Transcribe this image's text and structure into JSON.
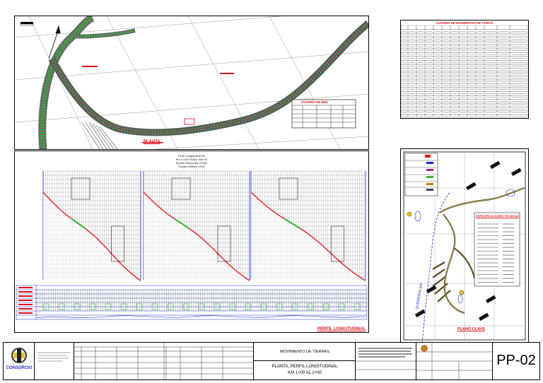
{
  "plan": {
    "title_label": "PLANTA",
    "table_title": "CUADRO DE BMs"
  },
  "curve_table": {
    "title": "CUADRO DE ELEMENTOS DE CURVA"
  },
  "profile": {
    "heading_lines": [
      "Perfil Longitudinal Nu",
      "Km 1+100.00@1+480.00",
      "Escala Horizontal 1/2000",
      "Escala Vertical 1/200"
    ],
    "title_label": "PERFIL LONGITUDINAL"
  },
  "location": {
    "specs_title": "ESPECIFICACIONES TECNICAS",
    "river_label": "QUEBRADA S/N",
    "map_title": "PLANO CLAVE"
  },
  "title_block": {
    "logo_text": "CONSORCIO",
    "subject": "MOVIMIENTO DE TIERRAS",
    "sheet_title_line1": "PLANTA, PERFIL LONGITUDINAL",
    "sheet_title_line2": "KM 1+00 AL 2+00",
    "sheet_code": "PP-02"
  },
  "colors": {
    "accent_red": "#e0101a",
    "terrain_green": "#2db52d",
    "road_magenta": "#c0148c",
    "grid_gray": "#888888",
    "frame_blue": "#1a2ad0"
  }
}
